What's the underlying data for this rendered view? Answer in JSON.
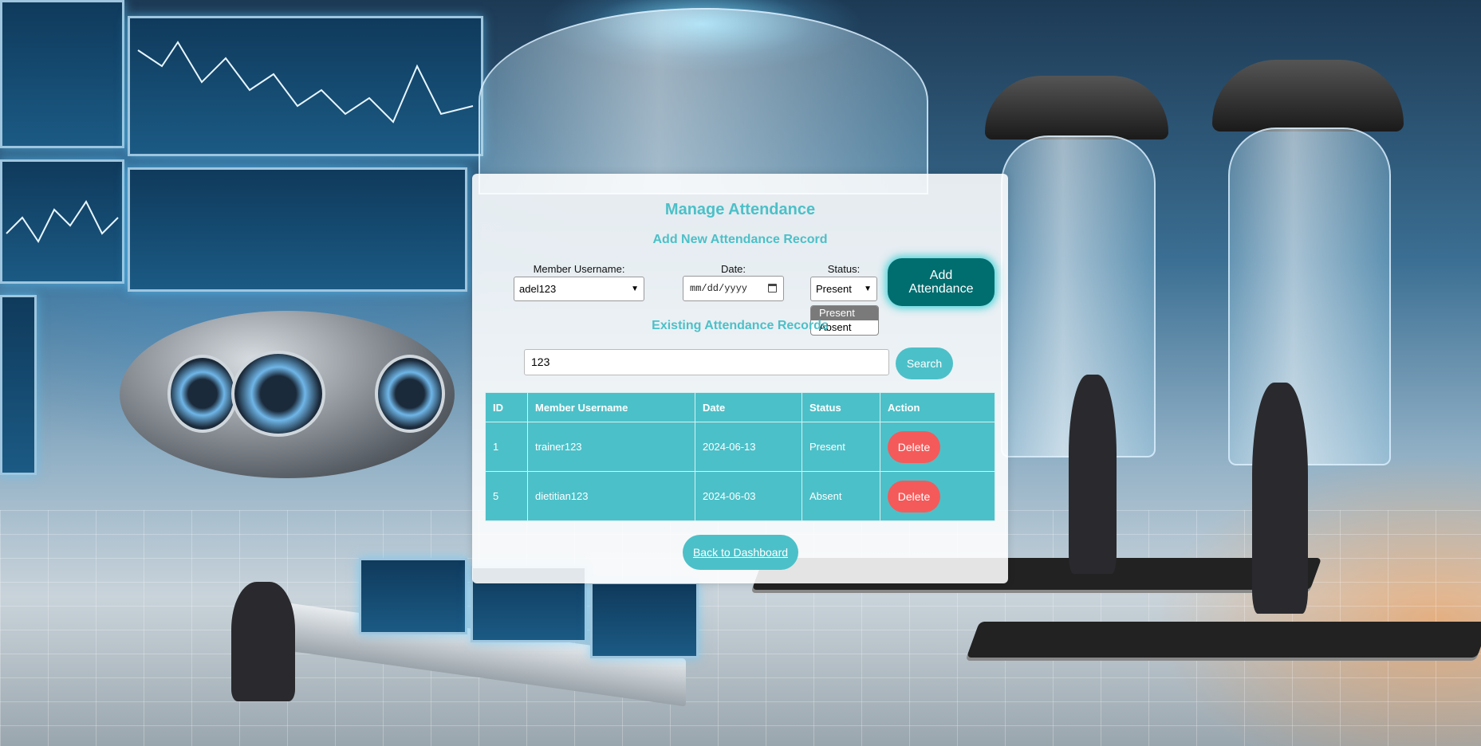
{
  "page": {
    "title": "Manage Attendance",
    "subtitle_add": "Add New Attendance Record",
    "subtitle_existing": "Existing Attendance Records"
  },
  "form": {
    "member_label": "Member Username:",
    "member_value": "adel123",
    "date_label": "Date:",
    "date_placeholder": "mm/dd/yyyy",
    "status_label": "Status:",
    "status_value": "Present",
    "status_options": [
      "Present",
      "Absent"
    ],
    "add_button": "Add Attendance"
  },
  "search": {
    "value": "123",
    "button": "Search"
  },
  "table": {
    "headers": [
      "ID",
      "Member Username",
      "Date",
      "Status",
      "Action"
    ],
    "rows": [
      {
        "id": "1",
        "username": "trainer123",
        "date": "2024-06-13",
        "status": "Present",
        "action": "Delete"
      },
      {
        "id": "5",
        "username": "dietitian123",
        "date": "2024-06-03",
        "status": "Absent",
        "action": "Delete"
      }
    ]
  },
  "footer": {
    "back_link": "Back to Dashboard"
  },
  "colors": {
    "accent": "#4cc0c8",
    "add_button": "#006d6f",
    "delete_button": "#f45a5a"
  },
  "icons": {
    "date": "calendar-icon"
  }
}
